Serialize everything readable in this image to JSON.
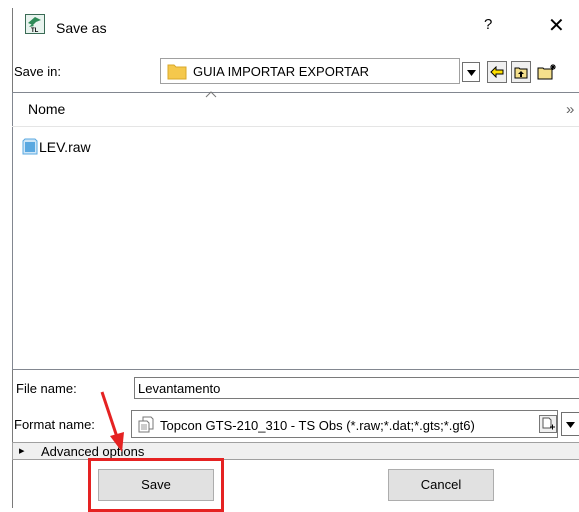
{
  "dialog": {
    "title": "Save as",
    "help_label": "?",
    "close_label": "✕"
  },
  "save_in": {
    "label": "Save in:",
    "folder": "GUIA IMPORTAR EXPORTAR"
  },
  "file_list": {
    "column_name": "Nome",
    "more_columns": "»",
    "items": [
      {
        "name": "LEV.raw"
      }
    ]
  },
  "file_name": {
    "label": "File name:",
    "value": "Levantamento"
  },
  "format_name": {
    "label": "Format name:",
    "value": "Topcon GTS-210_310 - TS Obs (*.raw;*.dat;*.gts;*.gt6)"
  },
  "advanced": {
    "label": "Advanced options",
    "arrow": "▸"
  },
  "buttons": {
    "save": "Save",
    "cancel": "Cancel"
  },
  "colors": {
    "annotation_red": "#e52222",
    "folder_yellow": "#f5c84c",
    "file_icon_blue": "#5aa8e0"
  }
}
